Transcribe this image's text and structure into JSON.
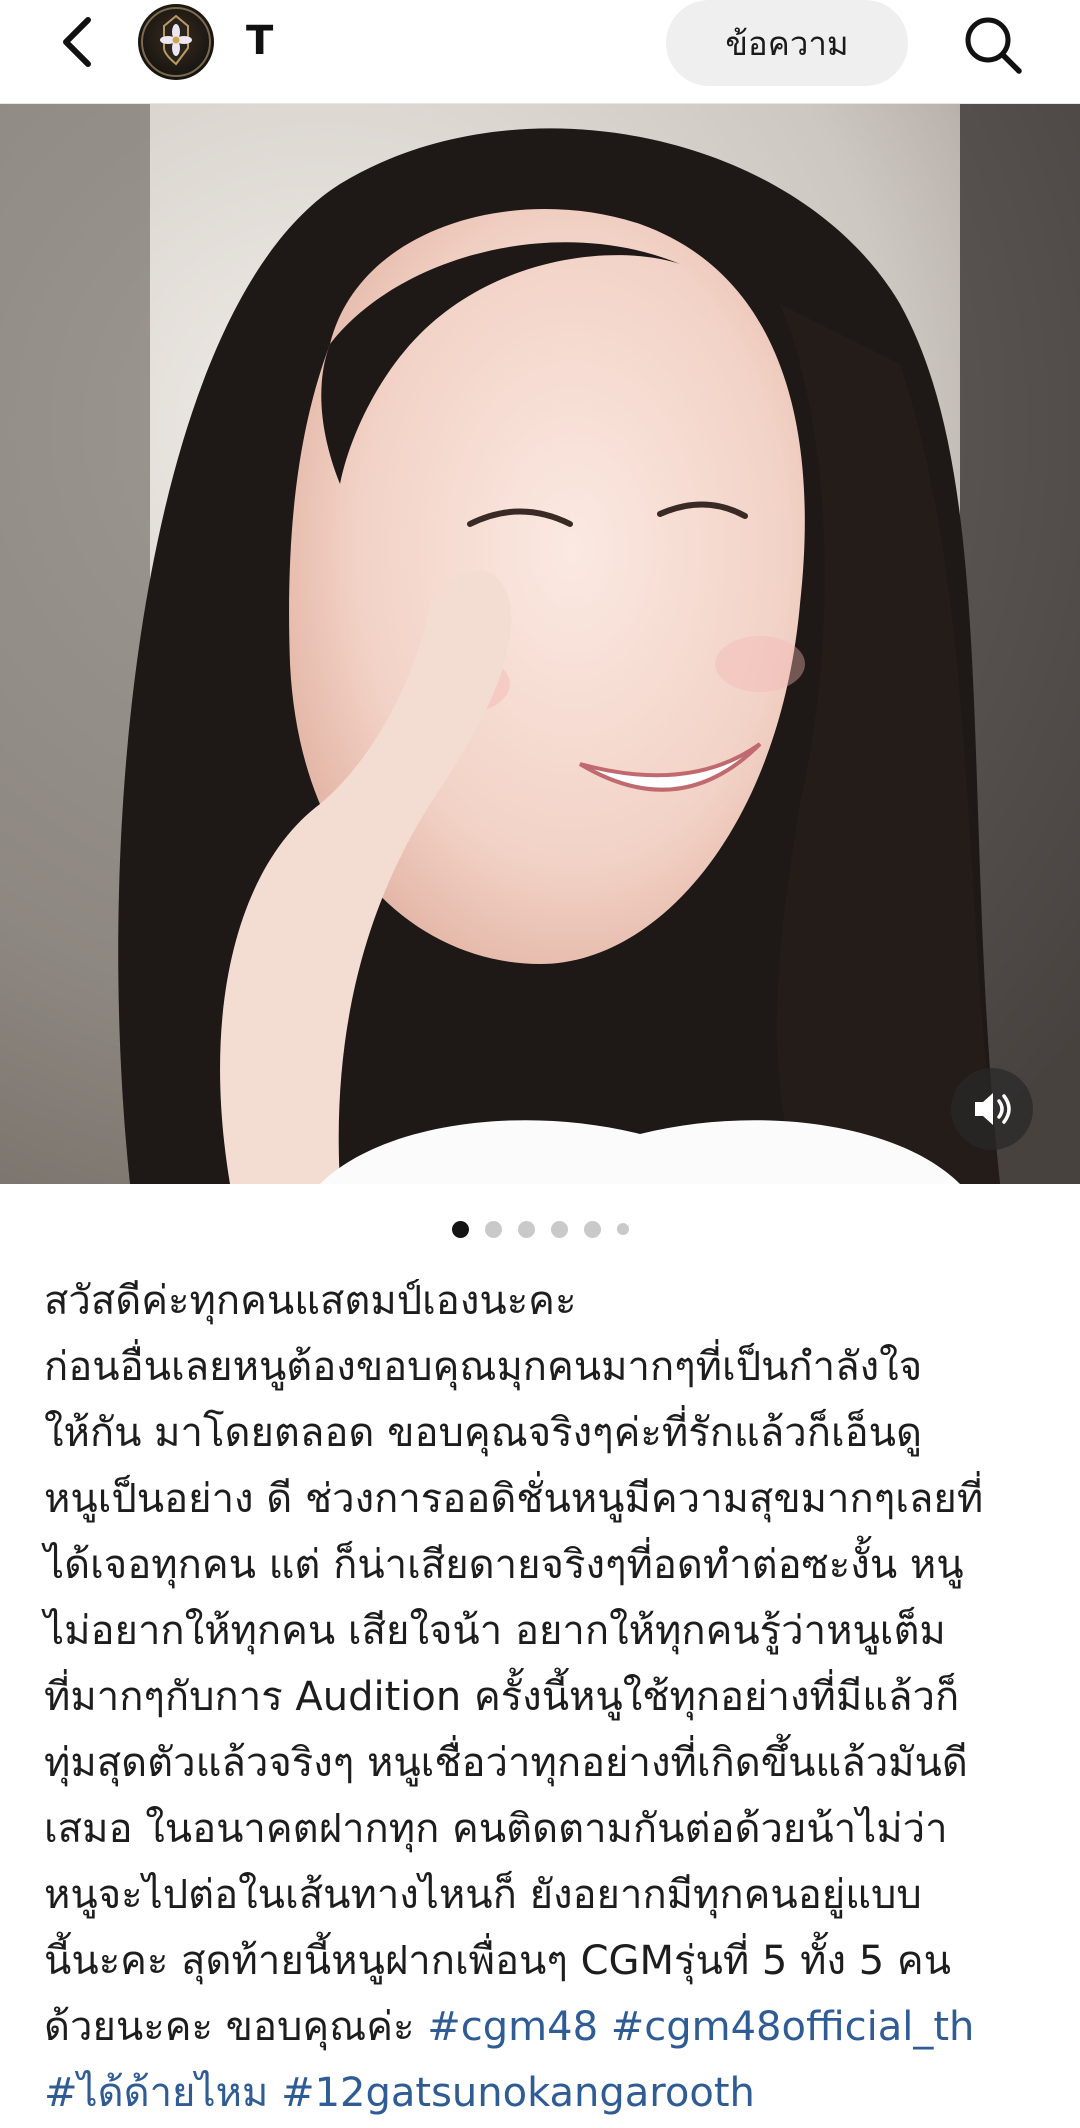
{
  "header": {
    "back_icon": "chevron-left-icon",
    "avatar_icon": "flower-emblem-icon",
    "name": "T",
    "message_label": "ข้อความ",
    "search_icon": "search-icon"
  },
  "media": {
    "mute_icon": "speaker-volume-icon",
    "carousel": {
      "total": 6,
      "active_index": 0
    }
  },
  "caption": {
    "lines": [
      "สวัสดีค่ะทุกคนแสตมป์เองนะคะ",
      "ก่อนอื่นเลยหนูต้องขอบคุณมุกคนมากๆที่เป็นกำลังใจ",
      "ให้กัน มาโดยตลอด ขอบคุณจริงๆค่ะที่รักแล้วก็เอ็นดู",
      "หนูเป็นอย่าง ดี ช่วงการออดิชั่นหนูมีความสุขมากๆเลยที่",
      "ได้เจอทุกคน แต่ ก็น่าเสียดายจริงๆที่อดทำต่อซะงั้น หนู",
      "ไม่อยากให้ทุกคน เสียใจน้า อยากให้ทุกคนรู้ว่าหนูเต็ม",
      "ที่มากๆกับการ Audition ครั้งนี้หนูใช้ทุกอย่างที่มีแล้วก็",
      "ทุ่มสุดตัวแล้วจริงๆ หนูเชื่อว่าทุกอย่างที่เกิดขึ้นแล้วมันดี",
      "เสมอ ในอนาคตฝากทุก คนติดตามกันต่อด้วยน้าไม่ว่า",
      "หนูจะไปต่อในเส้นทางไหนก็ ยังอยากมีทุกคนอยู่แบบ",
      "นี้นะคะ สุดท้ายนี้หนูฝากเพื่อนๆ CGMรุ่นที่ 5 ทั้ง 5 คน"
    ],
    "closing_text": "ด้วยนะคะ ขอบคุณค่ะ",
    "hashtags": [
      "#cgm48",
      "#cgm48official_th",
      "#ได้ด้ายไหม",
      "#12gatsunokangarooth"
    ]
  },
  "colors": {
    "hashtag": "#2f5c95",
    "button_bg": "#efefef",
    "dot_active": "#141414",
    "dot_inactive": "#c9c9c9"
  }
}
